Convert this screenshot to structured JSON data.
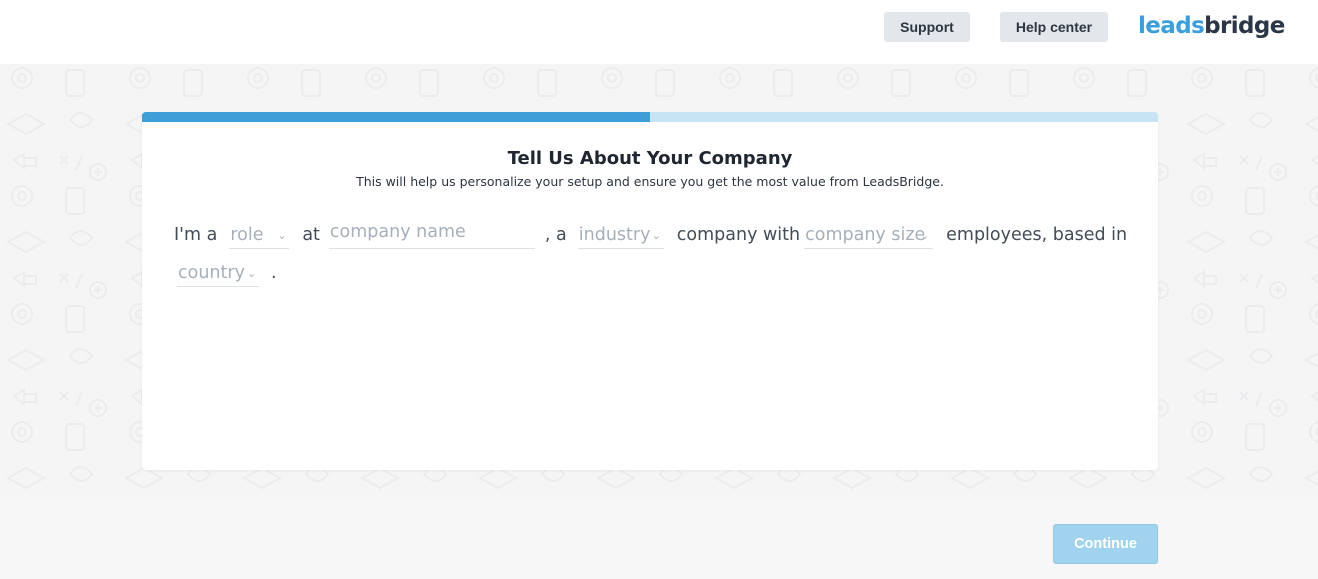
{
  "header": {
    "support_label": "Support",
    "help_center_label": "Help center",
    "logo_leads": "leads",
    "logo_bridge": "bridge"
  },
  "onboarding": {
    "progress_fraction": 0.5,
    "title": "Tell Us About Your Company",
    "subtitle": "This will help us personalize your setup and ensure you get the most value from LeadsBridge.",
    "sentence": {
      "im_a": "I'm a",
      "role_placeholder": "role",
      "at": "at",
      "company_name_placeholder": "company name",
      "comma_a": ", a",
      "industry_placeholder": "industry",
      "company_with": "company with",
      "company_size_placeholder": "company size",
      "employees_based_in": "employees, based in",
      "country_placeholder": "country",
      "period": "."
    }
  },
  "footer": {
    "continue_label": "Continue"
  },
  "colors": {
    "accent": "#3e9fd8",
    "progress_track": "#c7e4f5",
    "continue_disabled": "#a1d2ee",
    "top_button_bg": "#e3e6ea"
  },
  "icons": {
    "dropdown": "chevron-down-icon",
    "background_pattern": "marketing-doodle-pattern"
  }
}
